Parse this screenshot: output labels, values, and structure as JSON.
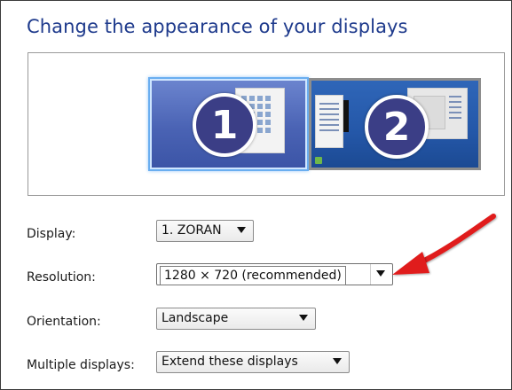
{
  "page": {
    "title": "Change the appearance of your displays"
  },
  "preview": {
    "monitors": [
      {
        "number": "1",
        "selected": true
      },
      {
        "number": "2",
        "selected": false
      }
    ]
  },
  "settings": {
    "display": {
      "label": "Display:",
      "value": "1. ZORAN"
    },
    "resolution": {
      "label": "Resolution:",
      "value": "1280 × 720 (recommended)"
    },
    "orientation": {
      "label": "Orientation:",
      "value": "Landscape"
    },
    "multiple_displays": {
      "label": "Multiple displays:",
      "value": "Extend these displays"
    }
  },
  "annotation": {
    "arrow_color": "#e01b1b",
    "icon": "red-arrow-icon"
  },
  "colors": {
    "title": "#1e3a8c",
    "selected_monitor": "#4a63b4",
    "monitor_2": "#2457a8",
    "monitor_badge": "#3b3e86"
  }
}
